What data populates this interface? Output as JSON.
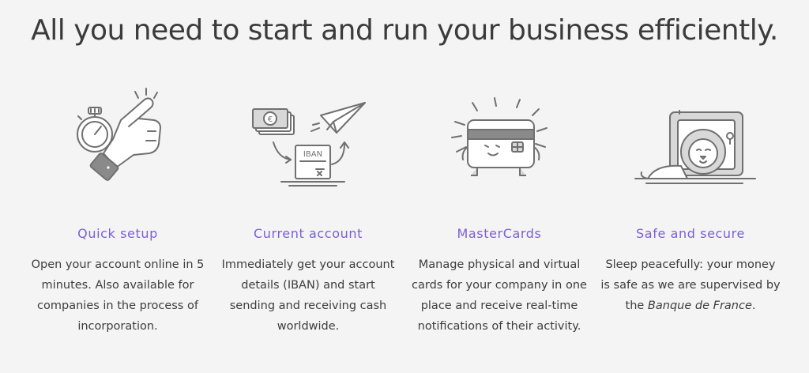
{
  "headline": "All you need to start and run your business efficiently.",
  "features": [
    {
      "title": "Quick setup",
      "description": "Open your account online in 5 minutes. Also available for companies in the process of incorporation."
    },
    {
      "title": "Current account",
      "description": "Immediately get your account details (IBAN) and start sending and receiving cash worldwide.",
      "iban_label": "IBAN"
    },
    {
      "title": "MasterCards",
      "description": "Manage physical and virtual cards for your company in one place and receive real-time notifications of their activity."
    },
    {
      "title": "Safe and secure",
      "description_prefix": "Sleep peacefully: your money is safe as we are supervised by the ",
      "description_emphasis": "Banque de France",
      "description_suffix": "."
    }
  ],
  "colors": {
    "background": "#f4f4f4",
    "accent": "#7b60d6",
    "text": "#3d3d3d",
    "icon_stroke": "#707070"
  },
  "icons": [
    "stopwatch-hand-icon",
    "money-iban-plane-icon",
    "card-character-icon",
    "lion-safe-icon"
  ]
}
